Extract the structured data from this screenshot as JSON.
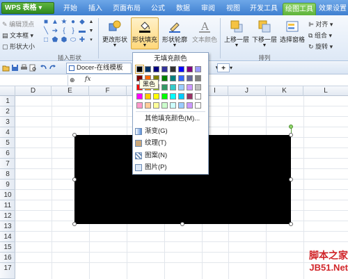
{
  "titlebar": {
    "app_name": "WPS 表格",
    "tabs": [
      "开始",
      "插入",
      "页面布局",
      "公式",
      "数据",
      "审阅",
      "视图",
      "开发工具",
      "绘图工具",
      "效果设置"
    ]
  },
  "ribbon": {
    "insert_shapes": {
      "edit_points": "编辑顶点",
      "textbox": "文本框",
      "shape_size": "形状大小",
      "group_caption": "插入形状"
    },
    "change_shape": "更改形状",
    "shape_fill": "形状填充",
    "shape_outline": "形状轮廓",
    "text_color": "文本颜色",
    "bring_forward": "上移一层",
    "send_backward": "下移一层",
    "selection_pane": "选择窗格",
    "arrange_caption": "排列",
    "align": "对齐",
    "group": "组合",
    "rotate": "旋转"
  },
  "toolbar": {
    "doc_tab": "Docer-在线模板"
  },
  "formula_bar": {
    "fx": "fx"
  },
  "sheet": {
    "columns": [
      "D",
      "E",
      "F",
      "G",
      "H",
      "I",
      "J",
      "K",
      "L"
    ],
    "rows": [
      "1",
      "2",
      "3",
      "4",
      "5",
      "6",
      "7",
      "8",
      "9",
      "10",
      "11",
      "12",
      "13",
      "14",
      "15",
      "16",
      "17"
    ]
  },
  "fill_menu": {
    "no_fill": "无填充颜色",
    "tooltip": "黑色",
    "palette": [
      [
        "#000000",
        "#003366",
        "#000080",
        "#333399",
        "#333333",
        "#0000ff",
        "#800080",
        "#9999ff"
      ],
      [
        "#800000",
        "#ff6600",
        "#808000",
        "#008000",
        "#008080",
        "#3366ff",
        "#666699",
        "#808080"
      ],
      [
        "#ff0000",
        "#ff9900",
        "#99cc00",
        "#339966",
        "#33cccc",
        "#99ccff",
        "#cc99ff",
        "#c0c0c0"
      ],
      [
        "#ff00ff",
        "#ffcc00",
        "#ffff00",
        "#00ff00",
        "#00ffff",
        "#00ccff",
        "#993366",
        "#ffffff"
      ],
      [
        "#ff99cc",
        "#ffcc99",
        "#ffff99",
        "#ccffcc",
        "#ccffff",
        "#99ccff",
        "#cc99ff",
        "#ffffff"
      ]
    ],
    "items": [
      "其他填充颜色(M)...",
      "渐变(G)",
      "纹理(T)",
      "图案(N)",
      "图片(P)"
    ]
  },
  "watermark": {
    "line1": "脚本之家",
    "line2": "JB51.Net"
  }
}
